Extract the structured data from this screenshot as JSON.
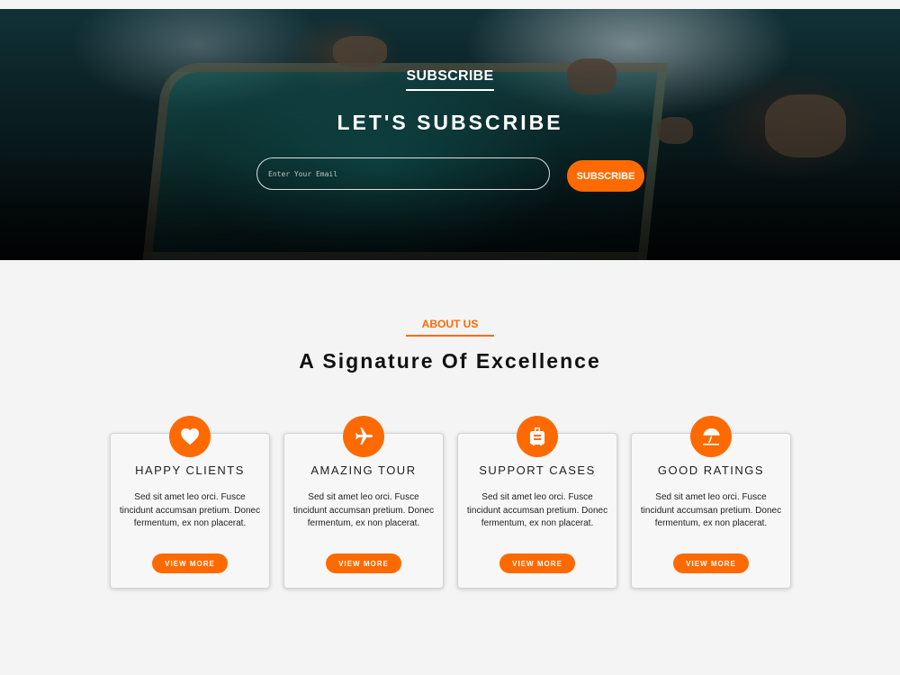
{
  "hero": {
    "kicker": "SUBSCRIBE",
    "title": "LET'S SUBSCRIBE",
    "email_placeholder": "Enter Your Email",
    "button_label": "SUBSCRIBE"
  },
  "about": {
    "kicker": "ABOUT US",
    "title": "A Signature Of Excellence",
    "cards": [
      {
        "icon": "heart-icon",
        "title": "HAPPY CLIENTS",
        "text": "Sed sit amet leo orci. Fusce tincidunt accumsan pretium. Donec fermentum, ex non placerat.",
        "button": "VIEW MORE"
      },
      {
        "icon": "airplane-icon",
        "title": "AMAZING TOUR",
        "text": "Sed sit amet leo orci. Fusce tincidunt accumsan pretium. Donec fermentum, ex non placerat.",
        "button": "VIEW MORE"
      },
      {
        "icon": "suitcase-icon",
        "title": "SUPPORT CASES",
        "text": "Sed sit amet leo orci. Fusce tincidunt accumsan pretium. Donec fermentum, ex non placerat.",
        "button": "VIEW MORE"
      },
      {
        "icon": "beach-umbrella-icon",
        "title": "GOOD RATINGS",
        "text": "Sed sit amet leo orci. Fusce tincidunt accumsan pretium. Donec fermentum, ex non placerat.",
        "button": "VIEW MORE"
      }
    ]
  },
  "colors": {
    "accent": "#ff6a00",
    "background": "#f4f4f4",
    "heading": "#111111"
  }
}
